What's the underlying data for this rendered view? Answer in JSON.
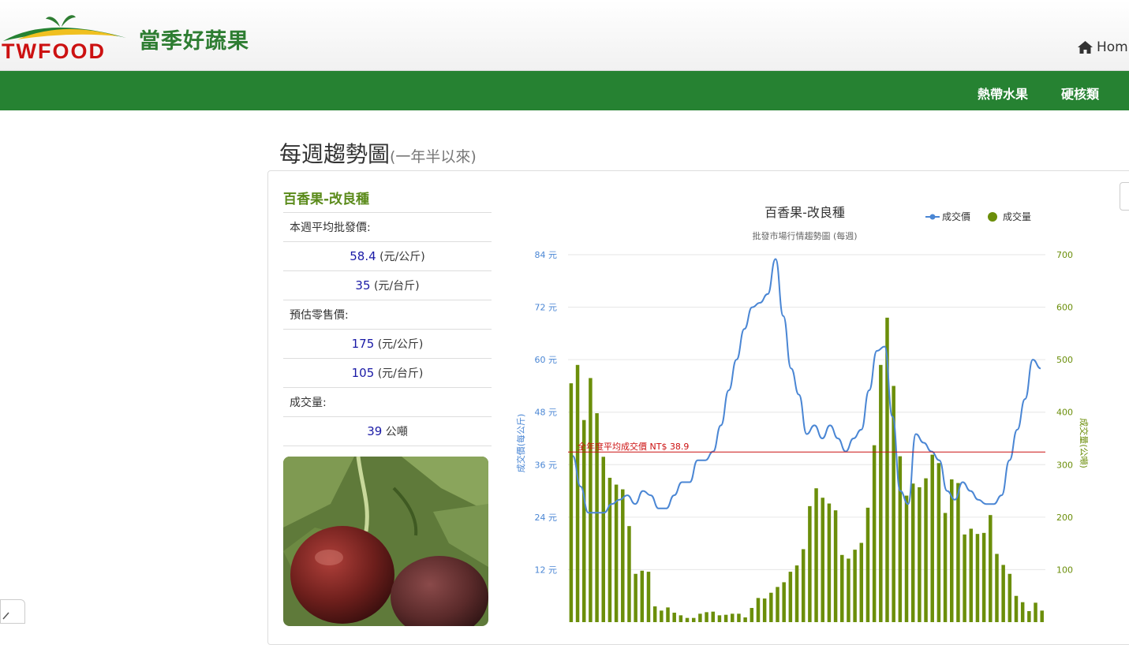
{
  "header": {
    "logo_text": "TWFOOD",
    "site_name": "當季好蔬果",
    "home_label": "Hom"
  },
  "nav": {
    "items": [
      {
        "label": "熱帶水果"
      },
      {
        "label": "硬核類"
      }
    ]
  },
  "page": {
    "title": "每週趨勢圖",
    "subtitle": "(一年半以來)"
  },
  "product": {
    "name": "百香果-改良種",
    "wholesale_label": "本週平均批發價:",
    "wholesale_per_kg": "58.4",
    "wholesale_per_kg_unit": "(元/公斤)",
    "wholesale_per_catty": "35",
    "wholesale_per_catty_unit": "(元/台斤)",
    "retail_label": "預估零售價:",
    "retail_per_kg": "175",
    "retail_per_kg_unit": "(元/公斤)",
    "retail_per_catty": "105",
    "retail_per_catty_unit": "(元/台斤)",
    "volume_label": "成交量:",
    "volume_value": "39",
    "volume_unit": "公噸"
  },
  "colors": {
    "brand_green": "#268232",
    "price_line": "#4a86d4",
    "volume_bar": "#6b8e0a",
    "avg_line": "#cc1111"
  },
  "chart_data": {
    "type": "bar",
    "title": "百香果-改良種",
    "subtitle": "批發市場行情趨勢圖 (每週)",
    "y_left_label": "成交價(每公斤)",
    "y_right_label": "成交量(公噸)",
    "y_left_ticks": [
      "84 元",
      "72 元",
      "60 元",
      "48 元",
      "36 元",
      "24 元",
      "12 元"
    ],
    "y_right_ticks": [
      "700",
      "600",
      "500",
      "400",
      "300",
      "200",
      "100"
    ],
    "y_left_range": [
      0,
      84
    ],
    "y_right_range": [
      0,
      700
    ],
    "grid": true,
    "legend_position": "top-right",
    "avg_label": "全年度平均成交價 NT$ 38.9",
    "avg_value": 38.9,
    "series": [
      {
        "name": "成交價",
        "type": "line",
        "axis": "left",
        "values": [
          38,
          31,
          25,
          25,
          25,
          27,
          28,
          29,
          27,
          30,
          29,
          26,
          26,
          29,
          32,
          32,
          37,
          37,
          39,
          45,
          53,
          60,
          67,
          72,
          73,
          75,
          83,
          70,
          58,
          52,
          43,
          45,
          42,
          45,
          42,
          39,
          42,
          44,
          53,
          62,
          63,
          47,
          30,
          27,
          43,
          41,
          39,
          37,
          30,
          28,
          32,
          30,
          28,
          27,
          27,
          29,
          37,
          44,
          51,
          60,
          58
        ]
      },
      {
        "name": "成交量",
        "type": "bar",
        "axis": "right",
        "values": [
          455,
          490,
          385,
          465,
          398,
          315,
          275,
          262,
          253,
          183,
          92,
          98,
          96,
          30,
          22,
          28,
          18,
          13,
          8,
          8,
          16,
          19,
          20,
          13,
          14,
          16,
          16,
          9,
          27,
          46,
          45,
          56,
          67,
          76,
          96,
          108,
          139,
          221,
          255,
          237,
          226,
          213,
          128,
          121,
          138,
          151,
          218,
          337,
          490,
          580,
          450,
          316,
          241,
          264,
          257,
          274,
          319,
          303,
          208,
          272,
          265,
          167,
          178,
          168,
          170,
          204,
          130,
          109,
          92,
          50,
          38,
          21,
          37,
          22
        ]
      }
    ]
  }
}
